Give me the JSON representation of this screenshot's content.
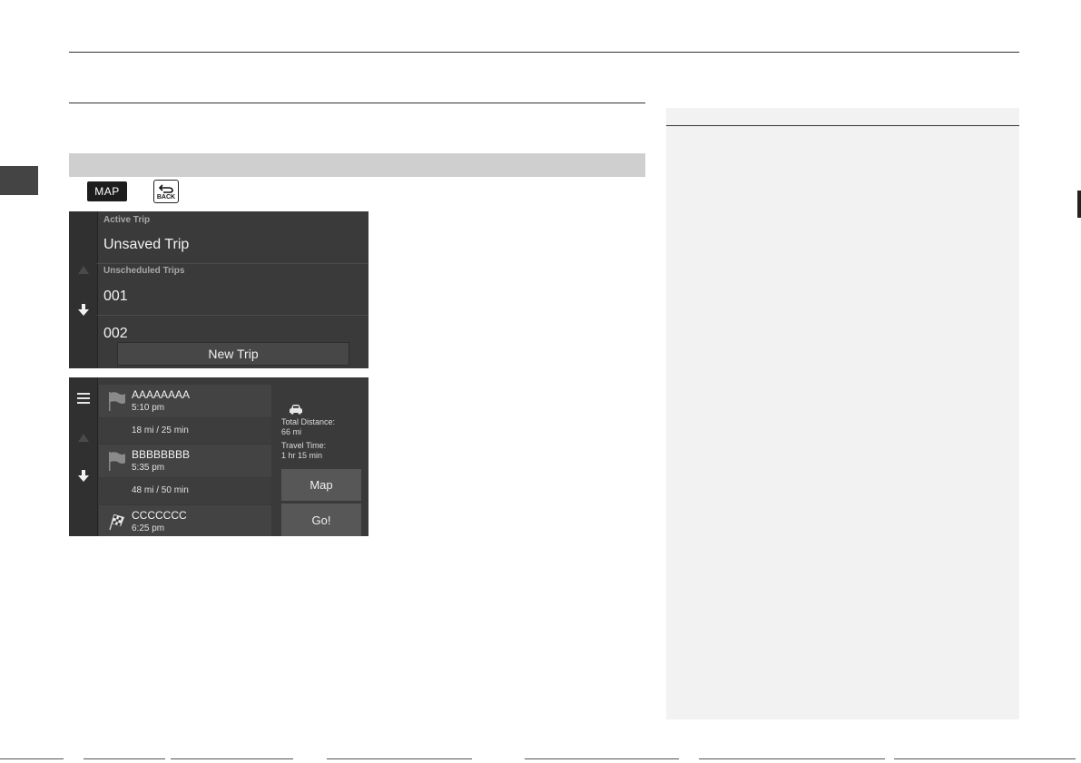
{
  "key_map_label": "MAP",
  "key_back_label": "BACK",
  "trips_screen": {
    "active_header": "Active Trip",
    "active_trip": "Unsaved Trip",
    "unscheduled_header": "Unscheduled Trips",
    "trips": [
      "001",
      "002"
    ],
    "new_trip_button": "New Trip"
  },
  "trip_detail_screen": {
    "stops": [
      {
        "name": "AAAAAAAA",
        "time": "5:10 pm",
        "icon": "flag-icon"
      },
      {
        "name": "BBBBBBBB",
        "time": "5:35 pm",
        "icon": "flag-icon"
      },
      {
        "name": "CCCCCCC",
        "time": "6:25 pm",
        "icon": "checkered-flag-icon"
      }
    ],
    "legs": [
      "18 mi / 25 min",
      "48 mi / 50 min"
    ],
    "total_distance_label": "Total Distance:",
    "total_distance_value": "66 mi",
    "travel_time_label": "Travel Time:",
    "travel_time_value": "1 hr 15 min",
    "map_button": "Map",
    "go_button": "Go!"
  }
}
